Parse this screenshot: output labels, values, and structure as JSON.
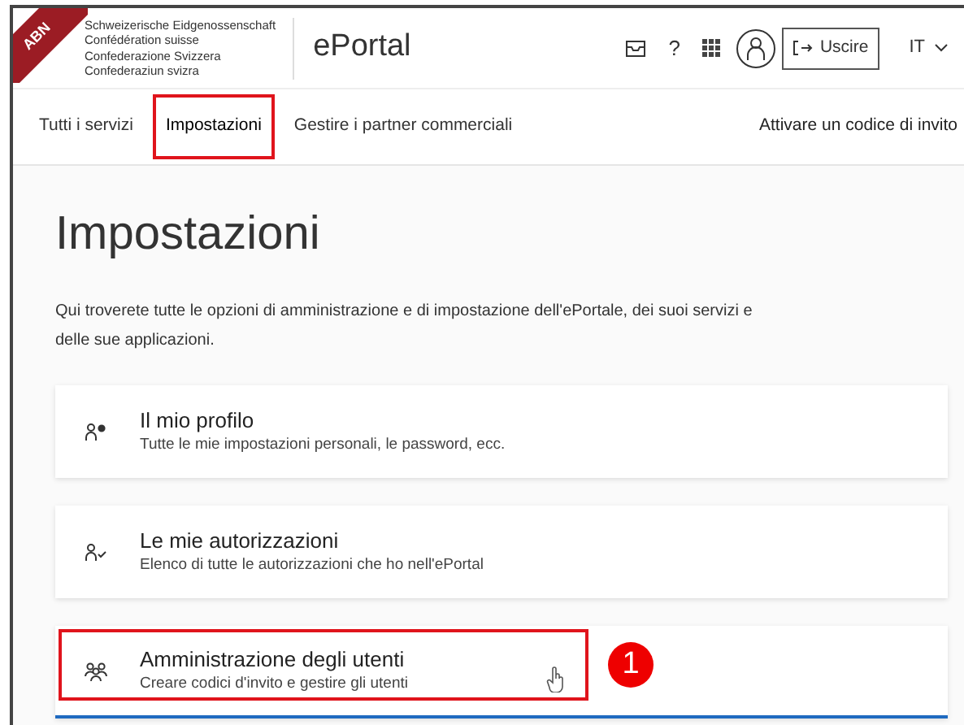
{
  "header": {
    "ribbon": "ABN",
    "federation": [
      "Schweizerische Eidgenossenschaft",
      "Confédération suisse",
      "Confederazione Svizzera",
      "Confederaziun svizra"
    ],
    "app_title": "ePortal",
    "help": "?",
    "logout": "Uscire",
    "language": "IT"
  },
  "tabs": [
    {
      "label": "Tutti i servizi",
      "selected": false,
      "highlighted": false
    },
    {
      "label": "Impostazioni",
      "selected": true,
      "highlighted": true
    },
    {
      "label": "Gestire i partner commerciali",
      "selected": false,
      "highlighted": false
    }
  ],
  "nav_link": "Attivare un codice di invito",
  "page": {
    "title": "Impostazioni",
    "intro": "Qui troverete tutte le opzioni di amministrazione e di impostazione dell'ePortale, dei suoi servizi e delle sue applicazioni."
  },
  "cards": [
    {
      "kind": "profile",
      "title": "Il mio profilo",
      "description": "Tutte le mie impostazioni personali, le password, ecc.",
      "highlighted": false,
      "hovered": false
    },
    {
      "kind": "permissions",
      "title": "Le mie autorizzazioni",
      "description": "Elenco di tutte le autorizzazioni che ho nell'ePortal",
      "highlighted": false,
      "hovered": false
    },
    {
      "kind": "users",
      "title": "Amministrazione degli utenti",
      "description": "Creare codici d'invito e gestire gli utenti",
      "highlighted": true,
      "hovered": true,
      "badge": "1"
    }
  ]
}
